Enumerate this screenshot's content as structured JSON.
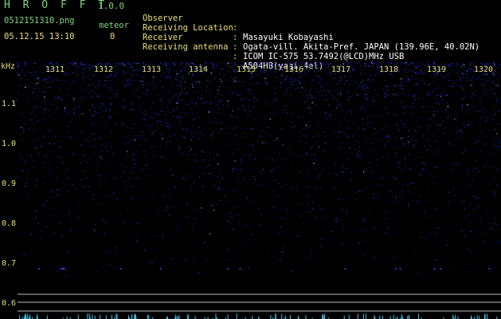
{
  "app": {
    "name": "H R O F F T",
    "version": "1.0.0"
  },
  "file": {
    "name": "0512151310.png",
    "datetime": "05.12.15 13:10"
  },
  "meteor": {
    "label": "meteor",
    "count": "0"
  },
  "info": [
    {
      "key": "Observer",
      "value": "Masayuki Kobayashi"
    },
    {
      "key": "Receiving Location",
      "value": "Ogata-vill. Akita-Pref. JAPAN (139.96E, 40.02N)"
    },
    {
      "key": "Receiver",
      "value": "ICOM IC-575 53.7492(@LCD)MHz USB"
    },
    {
      "key": "Receiving antenna",
      "value": "A504HB(yagi 4el)"
    }
  ],
  "axis": {
    "unit": "kHz",
    "freq_labels": [
      "1.1",
      "1.0",
      "0.9",
      "0.8",
      "0.7",
      "0.6"
    ],
    "time_labels": [
      "1311",
      "1312",
      "1313",
      "1314",
      "1315",
      "1316",
      "1317",
      "1318",
      "1319",
      "1320"
    ]
  },
  "colors": {
    "label": "#e7e07a",
    "header": "#7fd67f",
    "noise": "#1a2ad0",
    "bright": "#5fb7ff"
  }
}
